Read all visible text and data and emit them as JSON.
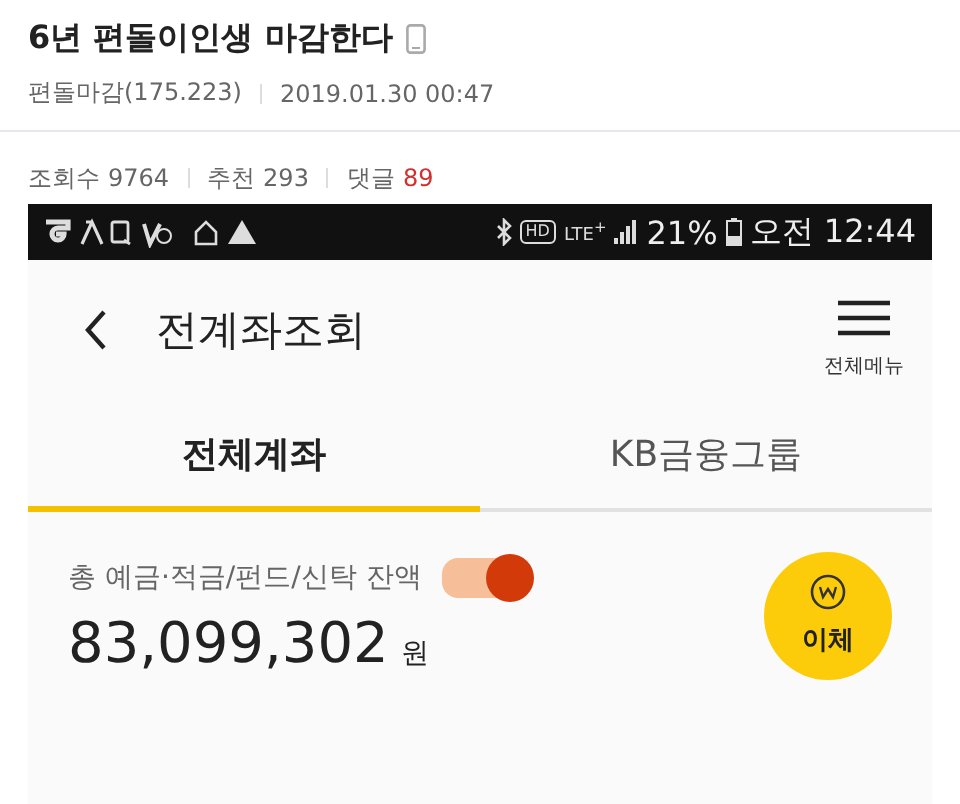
{
  "post": {
    "title": "6년 편돌이인생 마감한다",
    "author": "편돌마감(175.223)",
    "date": "2019.01.30 00:47",
    "stats": [
      {
        "label": "조회수",
        "value": "9764",
        "highlight": false
      },
      {
        "label": "추천",
        "value": "293",
        "highlight": false
      },
      {
        "label": "댓글",
        "value": "89",
        "highlight": true
      }
    ]
  },
  "phone": {
    "status_bar": {
      "hd": "HD",
      "network": "LTE$^{+}$",
      "battery": "21%",
      "time": "오전 12:44"
    },
    "app_bar": {
      "title": "전계좌조회",
      "menu_label": "전체메뉴"
    },
    "tabs": [
      {
        "label": "전체계좌",
        "selected": true
      },
      {
        "label": "KB금융그룹",
        "selected": false
      }
    ],
    "balance": {
      "label": "총 예금·적금/펀드/신탁 잔액",
      "show_toggle_on": true,
      "amount": "83,099,302",
      "unit": "원",
      "transfer_button": "이체"
    }
  }
}
